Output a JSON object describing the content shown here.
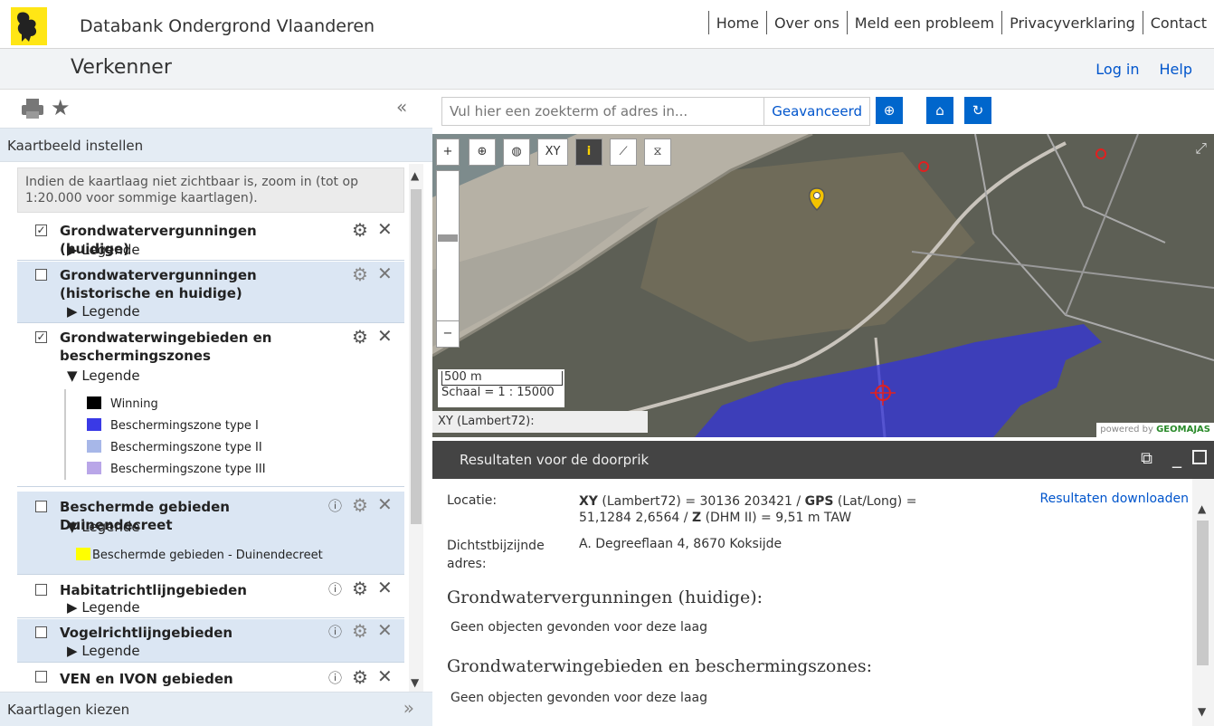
{
  "header": {
    "site_name": "Databank Ondergrond Vlaanderen",
    "nav": [
      "Home",
      "Over ons",
      "Meld een probleem",
      "Privacyverklaring",
      "Contact"
    ]
  },
  "subheader": {
    "title": "Verkenner",
    "links": [
      "Log in",
      "Help"
    ]
  },
  "sidebar": {
    "section_title": "Kaartbeeld instellen",
    "notice": "Indien de kaartlaag niet zichtbaar is, zoom in (tot op 1:20.000 voor sommige kaartlagen).",
    "bottom_title": "Kaartlagen kiezen",
    "legend_label": "Legende",
    "layers": [
      {
        "name": "Grondwatervergunningen (huidige)",
        "checked": true,
        "legend_expanded": false
      },
      {
        "name": "Grondwatervergunningen (historische en huidige)",
        "checked": false,
        "legend_expanded": false
      },
      {
        "name": "Grondwaterwingebieden en beschermingszones",
        "checked": true,
        "legend_expanded": true,
        "legend": [
          {
            "label": "Winning",
            "color": "#000000"
          },
          {
            "label": "Beschermingszone type I",
            "color": "#3a3ae6"
          },
          {
            "label": "Beschermingszone type II",
            "color": "#a7b7e8"
          },
          {
            "label": "Beschermingszone type III",
            "color": "#b9a6e8"
          }
        ]
      },
      {
        "name": "Beschermde gebieden Duinendecreet",
        "checked": false,
        "legend_expanded": true,
        "legend": [
          {
            "label": "Beschermde gebieden - Duinendecreet",
            "color": "#ffff00"
          }
        ]
      },
      {
        "name": "Habitatrichtlijngebieden",
        "checked": false,
        "legend_expanded": false
      },
      {
        "name": "Vogelrichtlijngebieden",
        "checked": false,
        "legend_expanded": false
      },
      {
        "name": "VEN en IVON gebieden",
        "checked": false,
        "legend_expanded": false
      }
    ]
  },
  "search": {
    "placeholder": "Vul hier een zoekterm of adres in...",
    "advanced_label": "Geavanceerd"
  },
  "map": {
    "tool_xy": "XY",
    "scale_bar": "500 m",
    "scale_text": "Schaal = 1 : 15000",
    "coord_text": "XY (Lambert72):",
    "powered_by": "powered by",
    "brand": "GEOMAJAS"
  },
  "results": {
    "title": "Resultaten voor de doorprik",
    "download_link": "Resultaten downloaden",
    "location_label": "Locatie:",
    "location_xy": "XY",
    "location_xy_suffix": "(Lambert72) = 30136 203421 /",
    "location_gps": "GPS",
    "location_gps_suffix": "(Lat/Long) =",
    "location_line2a": "51,1284 2,6564 /",
    "location_z": "Z",
    "location_z_suffix": "(DHM II) = 9,51 m TAW",
    "address_label": "Dichtstbijzijnde adres:",
    "address_value": "A. Degreeflaan 4, 8670 Koksijde",
    "section1_title": "Grondwatervergunningen (huidige):",
    "section1_text": "Geen objecten gevonden voor deze laag",
    "section2_title": "Grondwaterwingebieden en beschermingszones:",
    "section2_text": "Geen objecten gevonden voor deze laag"
  }
}
